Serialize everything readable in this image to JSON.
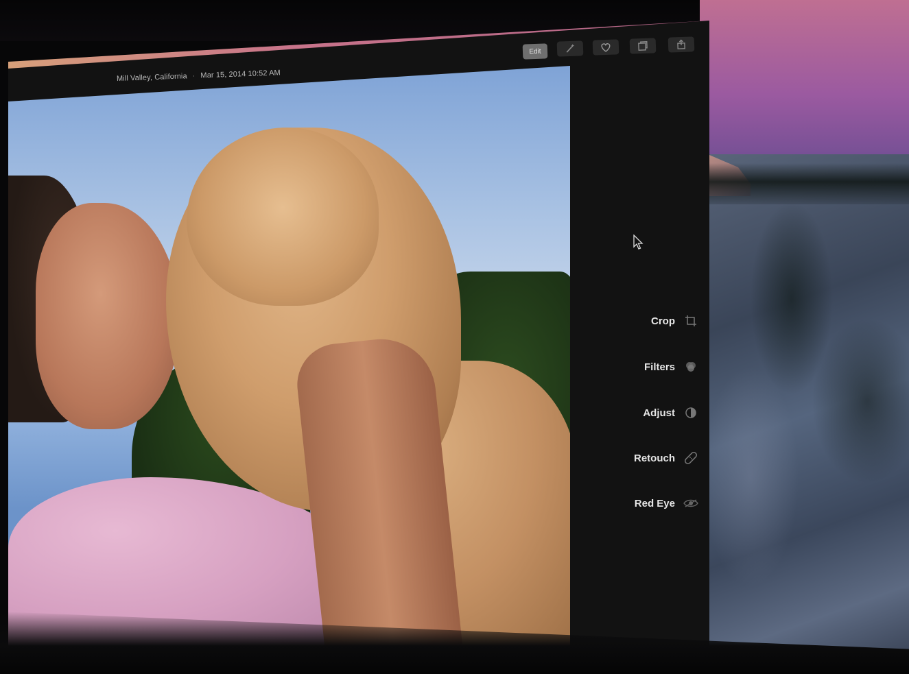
{
  "photo": {
    "location": "Mill Valley, California",
    "separator": "·",
    "datetime": "Mar 15, 2014 10:52 AM"
  },
  "toolbar": {
    "edit_label": "Edit",
    "buttons": [
      {
        "name": "enhance",
        "icon": "magic-wand-icon"
      },
      {
        "name": "favorite",
        "icon": "heart-icon"
      },
      {
        "name": "add-to",
        "icon": "add-to-album-icon"
      },
      {
        "name": "share",
        "icon": "share-icon"
      }
    ]
  },
  "edit_tools": [
    {
      "label": "Crop",
      "icon": "crop-icon"
    },
    {
      "label": "Filters",
      "icon": "filters-icon"
    },
    {
      "label": "Adjust",
      "icon": "adjust-icon"
    },
    {
      "label": "Retouch",
      "icon": "bandage-icon"
    },
    {
      "label": "Red Eye",
      "icon": "red-eye-icon"
    }
  ],
  "colors": {
    "window_bg": "#121212",
    "panel_text": "#e6e6e6",
    "edit_button_bg": "#6f6f6f"
  }
}
